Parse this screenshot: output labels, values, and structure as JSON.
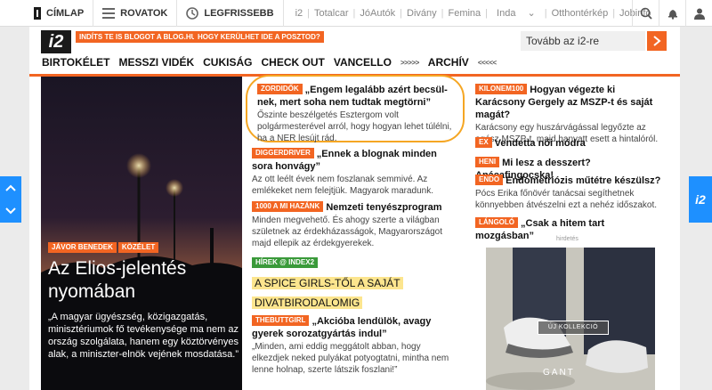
{
  "topbar": {
    "nav": [
      {
        "label": "CÍMLAP",
        "icon": "i2-icon"
      },
      {
        "label": "ROVATOK",
        "icon": "hamburger-icon"
      },
      {
        "label": "LEGFRISSEBB",
        "icon": "clock-icon"
      }
    ],
    "links": [
      "i2",
      "Totalcar",
      "JóAutók",
      "Divány",
      "Femina",
      "Inda",
      "Otthontérkép",
      "Jobinfo"
    ],
    "links_dropdown_index": 5,
    "icons": [
      "search-icon",
      "bell-icon",
      "user-icon"
    ]
  },
  "header": {
    "logo": "i2",
    "promo_1": "INDÍTS TE IS BLOGOT A BLOG.HU-N!",
    "promo_2": "HOGY KERÜLHET IDE A POSZTOD?",
    "search_placeholder": "Tovább az i2-re",
    "nav": [
      "BIRTOKÉLET",
      "MESSZI VIDÉK",
      "CUKISÁG",
      "CHECK OUT",
      "VANCELLO",
      ">>>>>",
      "ARCHÍV",
      "<<<<<"
    ]
  },
  "feature": {
    "tags": [
      "JÁVOR BENEDEK",
      "KÖZÉLET"
    ],
    "title": "Az Elios-jelentés nyomában",
    "desc": "„A magyar ügyészség, közigazgatás, minisztériumok fő tevékenysége ma nem az ország szolgálata, hanem egy köztörvényes alak, a miniszter-elnök vejének mosdatása.”"
  },
  "middle": [
    {
      "tag": "ZORDIDŐK",
      "title": "„Engem legalább azért becsül-nek, mert soha nem tudtak megtörni”",
      "text": "Őszinte beszélgetés Esztergom volt polgármesterével arról, hogy hogyan lehet túlélni, ha a NER lesújt rád."
    },
    {
      "tag": "DIGGERDRIVER",
      "title": "„Ennek a blognak minden sora honvágy”",
      "text": "Az ott leélt évek nem foszlanak semmivé. Az emlékeket nem felejtjük. Magyarok maradunk."
    },
    {
      "tag": "1000 A MI HAZÁNK",
      "title": "Nemzeti tenyészprogram",
      "text": "Minden megvehető. És ahogy szerte a világban születnek az érdekházasságok, Magyarországot majd ellepik az érdekgyerekek."
    },
    {
      "tag": "HÍREK @ INDEX2",
      "title": "A SPICE GIRLS-TŐL A SAJÁT DIVATBIRODALOMIG",
      "text": ""
    },
    {
      "tag": "THEBUTTGIRL",
      "title": "„Akcióba lendülök, avagy gyerek sorozatgyártás indul”",
      "text": "„Minden, ami eddig meggátolt abban, hogy elkezdjek neked pulyákat potyogtatni, mintha nem lenne holnap, szerte látszik foszlani!”"
    }
  ],
  "right": [
    {
      "tag": "KILONEM100",
      "title": "Hogyan végezte ki Karácsony Gergely az MSZP-t és saját magát?",
      "text": "Karácsony egy huszárvágással legyőzte az egész MSZP-t, majd hanyatt esett a hintalóról."
    },
    {
      "tag": "EX",
      "title": "Vendetta női módra",
      "text": ""
    },
    {
      "tag": "HENI",
      "title": "Mi lesz a desszert? Apácafingocska!",
      "text": ""
    },
    {
      "tag": "ENDO",
      "title": "Endometriózis műtétre készülsz?",
      "text": "Pócs Erika főnövér tanácsai segíthetnek könnyebben átvészelni ezt a nehéz időszakot."
    },
    {
      "tag": "LÁNGOLÓ",
      "title": "„Csak a hitem tart mozgásban”",
      "text": ""
    }
  ],
  "ad": {
    "label": "hirdetés",
    "button": "ÚJ KOLLEKCIÓ",
    "brand": "GANT"
  },
  "side": {
    "logo": "i2"
  }
}
